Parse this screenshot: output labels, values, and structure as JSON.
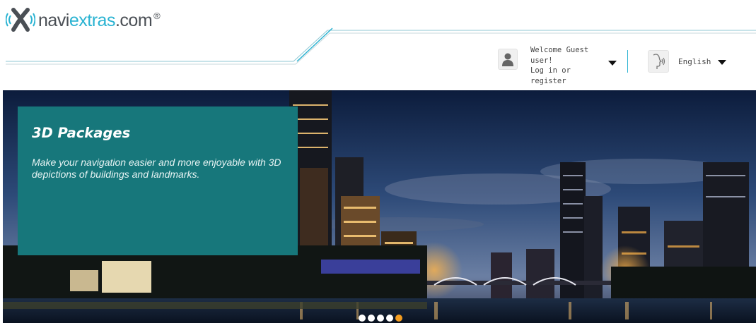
{
  "brand": {
    "logo_part1": "navi",
    "logo_part2": "extras",
    "logo_part3": ".com",
    "registered": "®",
    "accent_color": "#2ab3d2"
  },
  "header": {
    "welcome_line1": "Welcome Guest",
    "welcome_line2": "user!",
    "login_link": "Log in or register",
    "language": "English"
  },
  "hero": {
    "title": "3D Packages",
    "description": "Make your navigation easier and more enjoyable with 3D depictions of buildings and landmarks.",
    "panel_color": "#17777b",
    "slide_count": 5,
    "active_slide": 5
  },
  "icons": {
    "user": "user-icon",
    "language": "speaking-head-icon",
    "dropdown": "caret-down-icon",
    "logo": "navigation-x-icon"
  }
}
